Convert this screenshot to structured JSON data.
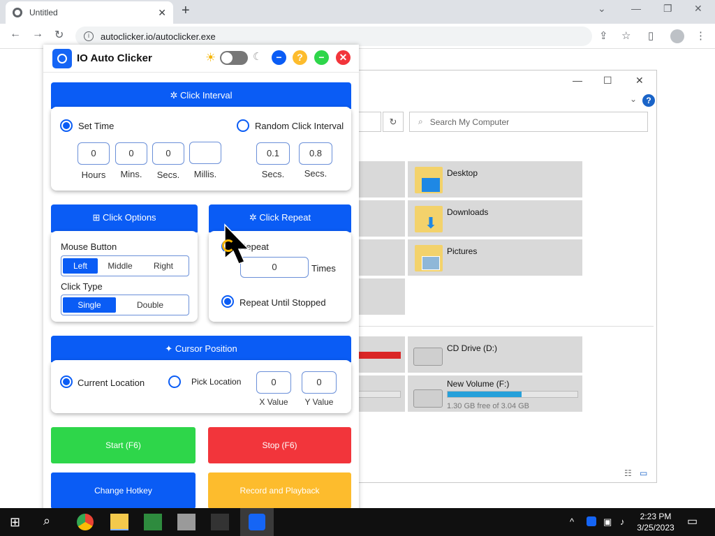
{
  "browser": {
    "tab_title": "Untitled",
    "new_tab": "+",
    "url": "autoclicker.io/autoclicker.exe"
  },
  "explorer": {
    "search_placeholder": "Search My Computer",
    "help": "?",
    "folders": [
      "Desktop",
      "Downloads",
      "Pictures"
    ],
    "drives": [
      {
        "name": "CD Drive (D:)"
      },
      {
        "name": "New Volume (F:)",
        "free_text": "1.30 GB free of 3.04 GB",
        "used_fraction": 0.57
      }
    ]
  },
  "app": {
    "title": "IO Auto Clicker",
    "header_buttons": {
      "minimize": "−",
      "help": "?",
      "maximize": "−",
      "close": "✕"
    },
    "click_interval": {
      "heading": "Click Interval",
      "set_time_label": "Set Time",
      "random_label": "Random Click Interval",
      "hours": "0",
      "mins": "0",
      "secs": "0",
      "millis": "",
      "hours_label": "Hours",
      "mins_label": "Mins.",
      "secs_label": "Secs.",
      "millis_label": "Millis.",
      "random_min": "0.1",
      "random_max": "0.8",
      "random_min_label": "Secs.",
      "random_max_label": "Secs."
    },
    "click_options": {
      "heading": "Click Options",
      "mouse_button_label": "Mouse Button",
      "buttons": [
        "Left",
        "Middle",
        "Right"
      ],
      "click_type_label": "Click Type",
      "types": [
        "Single",
        "Double"
      ]
    },
    "click_repeat": {
      "heading": "Click Repeat",
      "repeat_label": "Repeat",
      "repeat_count": "0",
      "times_label": "Times",
      "until_stopped_label": "Repeat Until Stopped"
    },
    "cursor_position": {
      "heading": "Cursor Position",
      "current_label": "Current Location",
      "pick_label": "Pick Location",
      "x": "0",
      "y": "0",
      "x_label": "X Value",
      "y_label": "Y Value"
    },
    "actions": {
      "start": "Start (F6)",
      "stop": "Stop (F6)",
      "hotkey": "Change Hotkey",
      "record": "Record and Playback"
    }
  },
  "taskbar": {
    "time": "2:23 PM",
    "date": "3/25/2023"
  },
  "colors": {
    "accent": "#0a5cf5",
    "start": "#2ed64a",
    "stop": "#f2353b",
    "hotkey": "#0a5cf5",
    "record": "#fdbc2d"
  }
}
